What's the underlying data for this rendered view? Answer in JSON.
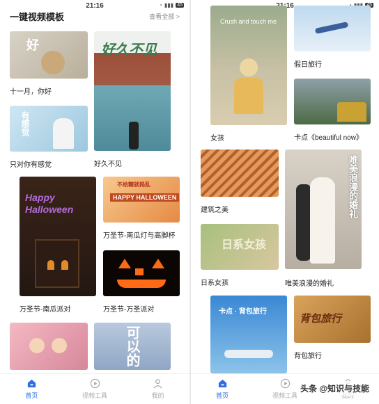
{
  "status": {
    "time": "21:16",
    "battery": "45"
  },
  "header": {
    "title": "一键视频模板",
    "see_all": "查看全部 >"
  },
  "left_cards": [
    {
      "caption": "十一月，你好",
      "overlay": "好"
    },
    {
      "caption": "好久不见",
      "overlay": "好久不见"
    },
    {
      "caption": "只对你有感觉",
      "overlay": "有感觉"
    },
    {
      "caption": "万圣节-南瓜派对",
      "overlay": "Happy Halloween"
    },
    {
      "caption": "万圣节-南瓜灯与高脚杯",
      "overlay": "HAPPY HALLOWEEN",
      "overlay_top": "不给糖就捣乱"
    },
    {
      "caption": "万圣节-万圣派对"
    },
    {
      "caption": ""
    },
    {
      "caption": "",
      "overlay": "可以的"
    }
  ],
  "right_cards": [
    {
      "caption": "女孩",
      "overlay": "Crush and touch me"
    },
    {
      "caption": "假日旅行"
    },
    {
      "caption": "卡点《beautiful now》"
    },
    {
      "caption": "建筑之美"
    },
    {
      "caption": "唯美浪漫的婚礼",
      "overlay": "唯美浪漫的婚礼"
    },
    {
      "caption": "日系女孩",
      "overlay": "日系女孩"
    },
    {
      "caption": "",
      "overlay": "卡点 · 背包旅行"
    },
    {
      "caption": "背包旅行",
      "overlay": "背包旅行"
    }
  ],
  "tabs": [
    {
      "label": "首页",
      "icon": "home-icon"
    },
    {
      "label": "视频工具",
      "icon": "play-icon"
    },
    {
      "label": "我的",
      "icon": "user-icon"
    }
  ],
  "watermark": "头条 @知识与技能",
  "colors": {
    "accent": "#2f6fe0"
  }
}
